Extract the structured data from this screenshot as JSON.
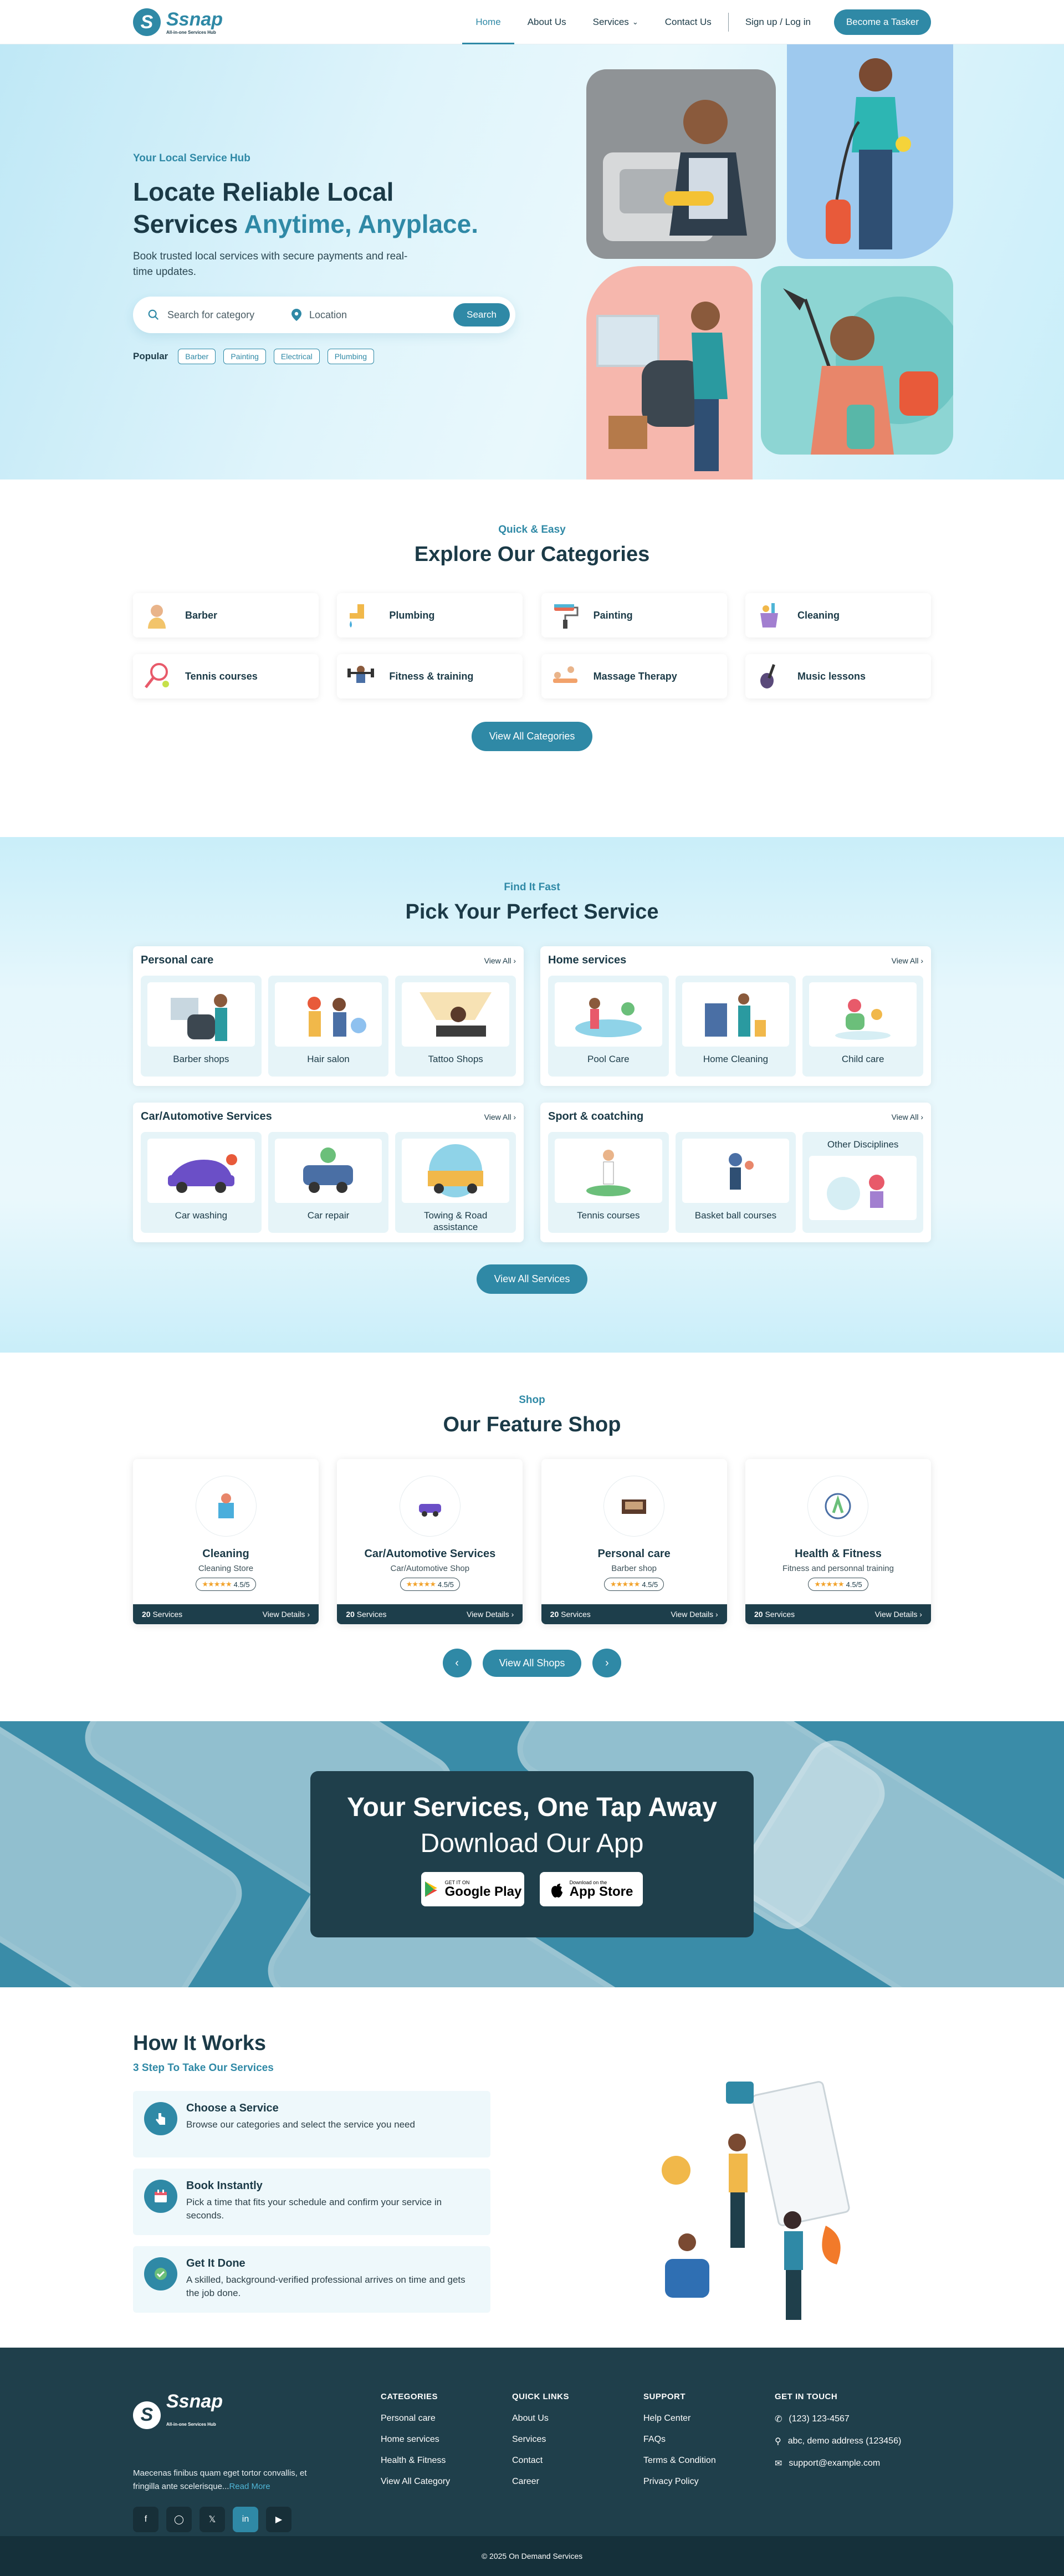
{
  "brand": {
    "name": "Ssnap",
    "tagline": "All-in-one Services Hub"
  },
  "nav": {
    "items": [
      "Home",
      "About Us",
      "Services",
      "Contact Us"
    ],
    "signup": "Sign up / Log in",
    "cta": "Become a Tasker"
  },
  "hero": {
    "eyebrow": "Your Local Service Hub",
    "title_line1": "Locate Reliable Local",
    "title_line2a": "Services ",
    "title_line2b": "Anytime, Anyplace.",
    "desc": "Book trusted local services with secure payments and real-time updates.",
    "search_category": "Search for category",
    "search_location": "Location",
    "search_btn": "Search",
    "popular_label": "Popular",
    "popular": [
      "Barber",
      "Painting",
      "Electrical",
      "Plumbing"
    ]
  },
  "categories": {
    "kicker": "Quick & Easy",
    "title": "Explore Our Categories",
    "items": [
      "Barber",
      "Plumbing",
      "Painting",
      "Cleaning",
      "Tennis courses",
      "Fitness & training",
      "Massage Therapy",
      "Music lessons"
    ],
    "btn": "View All Categories"
  },
  "services": {
    "kicker": "Find It Fast",
    "title": "Pick Your Perfect Service",
    "view_all": "View All",
    "groups": [
      {
        "name": "Personal care",
        "items": [
          "Barber shops",
          "Hair salon",
          "Tattoo Shops"
        ]
      },
      {
        "name": "Home services",
        "items": [
          "Pool Care",
          "Home Cleaning",
          "Child care"
        ]
      },
      {
        "name": "Car/Automotive Services",
        "items": [
          "Car washing",
          "Car repair",
          "Towing & Road assistance"
        ]
      },
      {
        "name": "Sport & coatching",
        "items": [
          "Tennis courses",
          "Basket ball courses"
        ],
        "other": "Other Disciplines"
      }
    ],
    "btn": "View All Services"
  },
  "shop": {
    "kicker": "Shop",
    "title": "Our Feature Shop",
    "cards": [
      {
        "name": "Cleaning",
        "sub": "Cleaning Store",
        "rating": "4.5/5",
        "count": "20",
        "count_label": "Services",
        "details": "View Details"
      },
      {
        "name": "Car/Automotive Services",
        "sub": "Car/Automotive Shop",
        "rating": "4.5/5",
        "count": "20",
        "count_label": "Services",
        "details": "View Details"
      },
      {
        "name": "Personal care",
        "sub": "Barber shop",
        "rating": "4.5/5",
        "count": "20",
        "count_label": "Services",
        "details": "View Details"
      },
      {
        "name": "Health & Fitness",
        "sub": "Fitness and personnal training",
        "rating": "4.5/5",
        "count": "20",
        "count_label": "Services",
        "details": "View Details"
      }
    ],
    "btn": "View All Shops",
    "prev": "‹",
    "next": "›"
  },
  "app": {
    "title": "Your Services, One Tap Away",
    "subtitle": "Download Our App",
    "gp_small": "GET IT ON",
    "gp_big": "Google Play",
    "as_small": "Download on the",
    "as_big": "App Store"
  },
  "how": {
    "title": "How It Works",
    "subtitle": "3 Step To Take Our Services",
    "steps": [
      {
        "title": "Choose a Service",
        "desc": "Browse our categories and select the service you need"
      },
      {
        "title": "Book Instantly",
        "desc": "Pick a time that fits your schedule and confirm your service in seconds."
      },
      {
        "title": "Get It Done",
        "desc": "A skilled, background-verified professional arrives on time and gets the job done."
      }
    ]
  },
  "footer": {
    "about": "Maecenas finibus quam eget tortor convallis, et fringilla ante scelerisque...",
    "read_more": "Read More",
    "cols": [
      {
        "title": "CATEGORIES",
        "items": [
          "Personal care",
          "Home services",
          "Health & Fitness",
          "View All Category"
        ]
      },
      {
        "title": "QUICK LINKS",
        "items": [
          "About Us",
          "Services",
          "Contact",
          "Career"
        ]
      },
      {
        "title": "SUPPORT",
        "items": [
          "Help Center",
          "FAQs",
          "Terms & Condition",
          "Privacy Policy"
        ]
      }
    ],
    "contact_title": "GET IN TOUCH",
    "phone": "(123) 123-4567",
    "address": "abc, demo address (123456)",
    "email": "support@example.com",
    "copyright": "© 2025 On Demand Services"
  },
  "colors": {
    "accent": "#2f89a6",
    "dark": "#1f3f4b",
    "light": "#e6f4f8"
  }
}
